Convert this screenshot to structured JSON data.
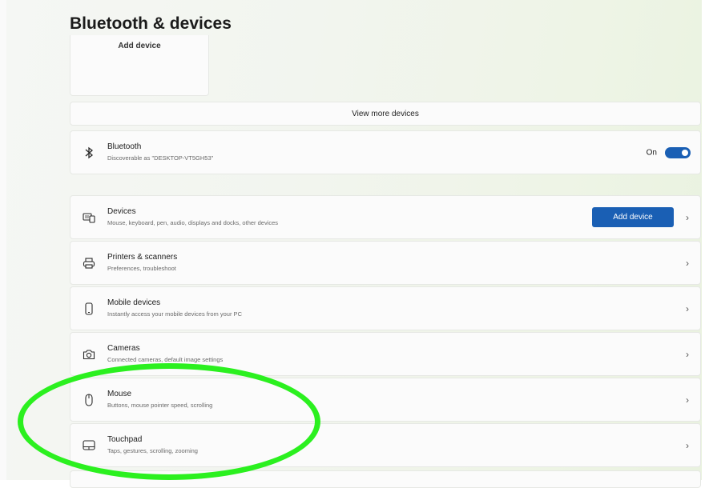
{
  "header": {
    "title": "Bluetooth & devices"
  },
  "tiles": {
    "add_device_label": "Add device"
  },
  "view_more": {
    "label": "View more devices"
  },
  "bluetooth": {
    "title": "Bluetooth",
    "subtitle": "Discoverable as \"DESKTOP-VT5GH53\"",
    "toggle_label": "On",
    "enabled": true
  },
  "rows": [
    {
      "icon": "devices-icon",
      "title": "Devices",
      "subtitle": "Mouse, keyboard, pen, audio, displays and docks, other devices",
      "button": "Add device"
    },
    {
      "icon": "printer-icon",
      "title": "Printers & scanners",
      "subtitle": "Preferences, troubleshoot"
    },
    {
      "icon": "phone-icon",
      "title": "Mobile devices",
      "subtitle": "Instantly access your mobile devices from your PC"
    },
    {
      "icon": "camera-icon",
      "title": "Cameras",
      "subtitle": "Connected cameras, default image settings"
    },
    {
      "icon": "mouse-icon",
      "title": "Mouse",
      "subtitle": "Buttons, mouse pointer speed, scrolling"
    },
    {
      "icon": "touchpad-icon",
      "title": "Touchpad",
      "subtitle": "Taps, gestures, scrolling, zooming"
    }
  ],
  "colors": {
    "accent": "#1a5fb4",
    "highlight": "#2bf01f"
  }
}
